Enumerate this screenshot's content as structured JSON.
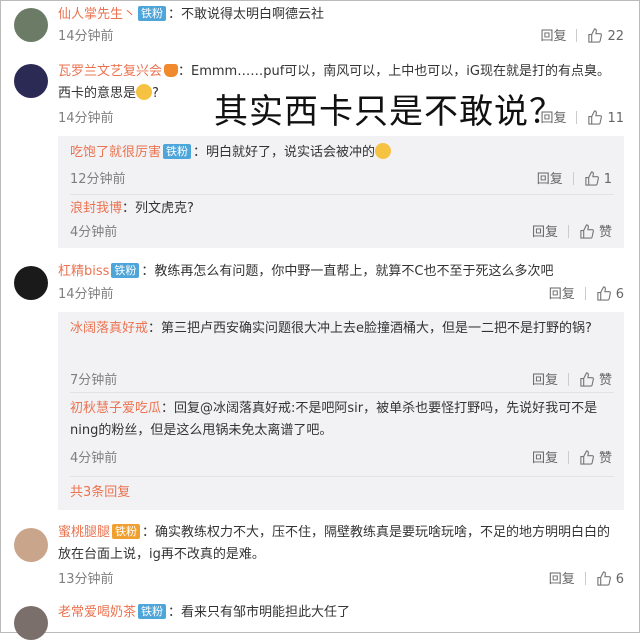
{
  "overlay_caption": "其实西卡只是不敢说？",
  "reply_label": "回复",
  "comments": [
    {
      "user": "仙人掌先生丶",
      "badge": "铁粉",
      "text": "：不敢说得太明白啊德云社",
      "time": "14分钟前",
      "likes": "22",
      "avatar_color": "#6b7b66"
    },
    {
      "user": "瓦罗兰文艺复兴会",
      "badge": "",
      "text": "：Emmm……puf可以，南风可以，上中也可以，iG现在就是打的有点臭。西卡的意思是",
      "text2": "?",
      "time": "14分钟前",
      "likes": "11",
      "avatar_color": "#2b2a55"
    },
    {
      "user": "杠精biss",
      "badge": "铁粉",
      "text": "：教练再怎么有问题，你中野一直帮上，就算不C也不至于死这么多次吧",
      "time": "14分钟前",
      "likes": "6",
      "avatar_color": "#1a1a1a"
    },
    {
      "user": "蜜桃腿腿",
      "badge": "铁粉",
      "text": "：确实教练权力不大，压不住，隔壁教练真是要玩啥玩啥，不足的地方明明白白的放在台面上说，ig再不改真的是难。",
      "time": "13分钟前",
      "likes": "6",
      "avatar_color": "#c9a58b"
    },
    {
      "user": "老常爱喝奶茶",
      "badge": "铁粉",
      "text": "：看来只有邹市明能担此大任了",
      "time": "",
      "likes": "",
      "avatar_color": "#7a6f6a"
    }
  ],
  "subreplies_1": [
    {
      "user": "吃饱了就很厉害",
      "badge": "铁粉",
      "text": "：明白就好了，说实话会被冲的",
      "time": "12分钟前",
      "likes": "1"
    },
    {
      "user": "浪封我博",
      "badge": "",
      "text": "：列文虎克?",
      "time": "4分钟前",
      "likes": "赞"
    }
  ],
  "subreplies_2": [
    {
      "user": "冰阔落真好戒",
      "badge": "",
      "text": "：第三把卢西安确实问题很大冲上去e脸撞酒桶大，但是一二把不是打野的锅?",
      "time": "7分钟前",
      "likes": "赞"
    },
    {
      "user": "初秋慧子爱吃瓜",
      "badge": "",
      "text": "：回复@冰阔落真好戒:不是吧阿sir，被单杀也要怪打野吗，先说好我可不是ning的粉丝，但是这么甩锅未免太离谱了吧。",
      "time": "4分钟前",
      "likes": "赞"
    }
  ],
  "more_replies": "共3条回复",
  "badge_gold": "铁粉",
  "colors": {
    "username": "#eb7350",
    "badge": "#4ea5d9",
    "subbox": "#f2f2f5",
    "time": "#808080"
  }
}
